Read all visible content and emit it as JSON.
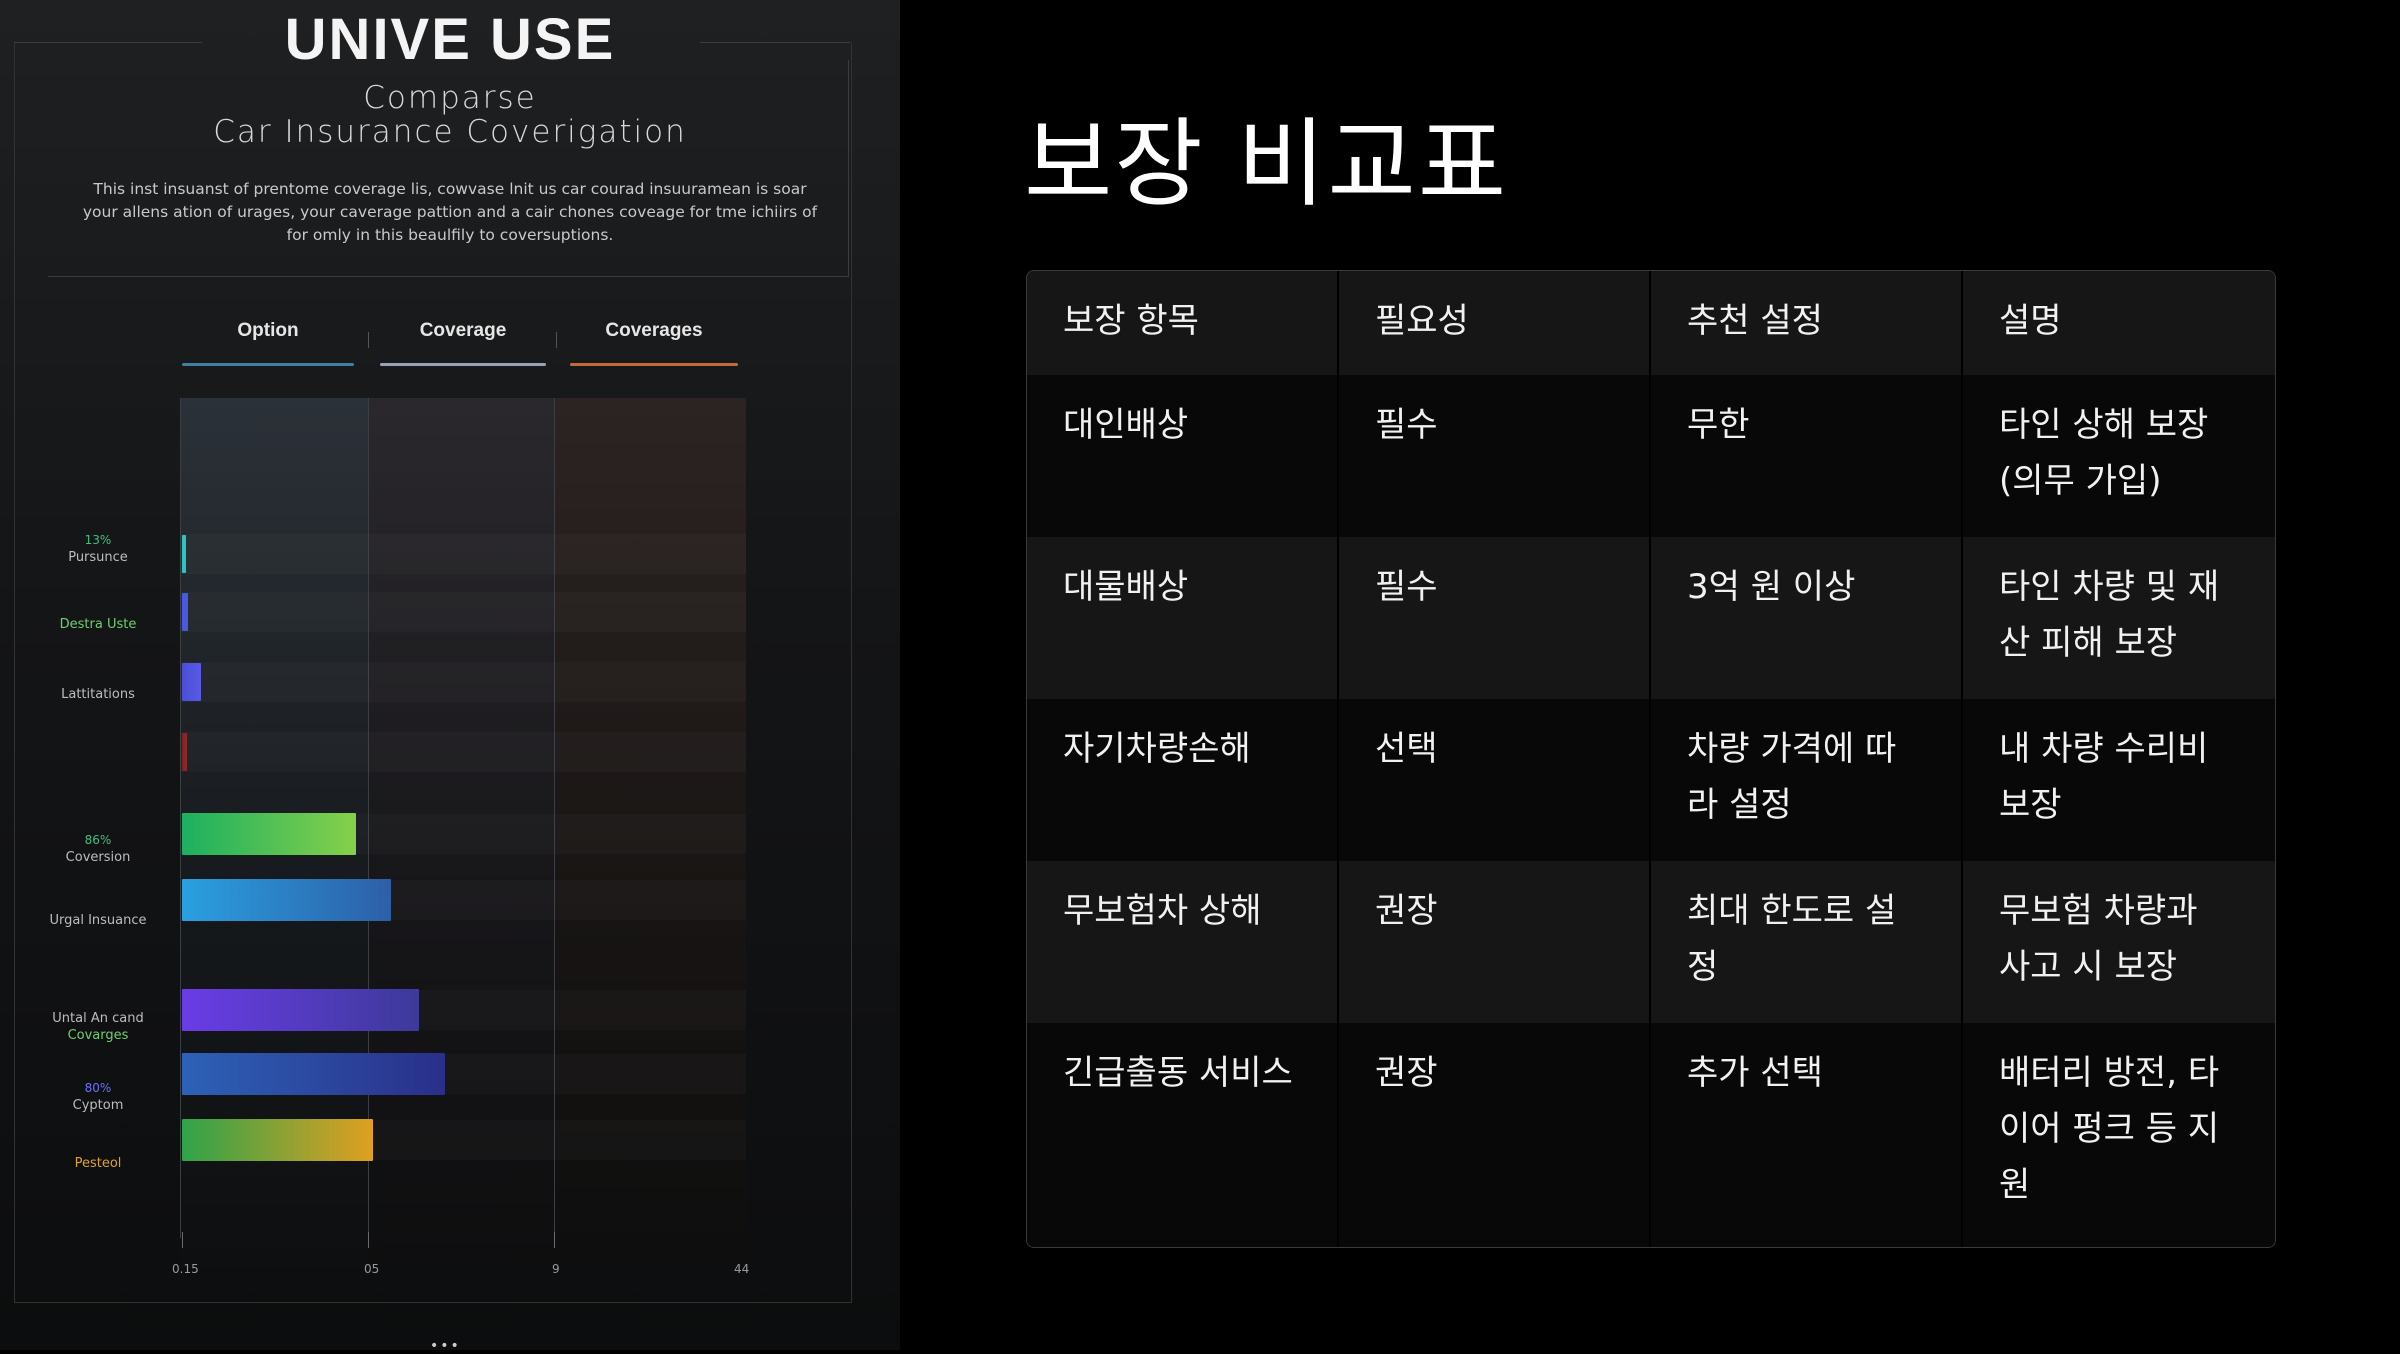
{
  "infographic": {
    "title": "UNIVE USE",
    "subtitle_line1": "Comparse",
    "subtitle_line2": "Car Insurance Coverigation",
    "description": "This inst insuanst of prentome coverage lis, cowvase lnit us car courad insuuramean is soar your allens ation of urages, your caverage pattion and a cair chones coveage for tme ichiirs of for omly in this beaulfily to coversuptions.",
    "tabs": [
      {
        "label": "Option",
        "color": "#3f7fa0"
      },
      {
        "label": "Coverage",
        "color": "#9aa3b6"
      },
      {
        "label": "Coverages",
        "color": "#c46a3a"
      }
    ],
    "rows": [
      {
        "pct": "13%",
        "label": "Pursunce",
        "pct_color": "#3fbf7f"
      },
      {
        "pct": "",
        "label": "Destra Uste",
        "label_color": "#6fcf6f"
      },
      {
        "pct": "",
        "label": "Lattitations"
      },
      {
        "pct": "",
        "label": ""
      },
      {
        "pct": "86%",
        "label": "Coversion",
        "pct_color": "#3fbf7f"
      },
      {
        "pct": "",
        "label": "Urgal Insuance"
      },
      {
        "pct": "",
        "label": "Untal An cand",
        "label2": "Covarges",
        "label2_color": "#6fcf6f"
      },
      {
        "pct": "80%",
        "label": "Cyptom",
        "pct_color": "#6f6fff"
      },
      {
        "pct": "",
        "label": "Pesteol",
        "label_color": "#e0a030"
      }
    ],
    "xticks": [
      "0.15",
      "05",
      "9",
      "44"
    ],
    "dots": "•••"
  },
  "chart_data": {
    "type": "bar",
    "categories": [
      "Pursunce",
      "Destra Uste",
      "Lattitations",
      "",
      "Coversion",
      "Urgal Insuance",
      "Untal An cand Covarges",
      "Cyptom",
      "Pesteol"
    ],
    "values": [
      0.2,
      0.4,
      1.2,
      0.3,
      11.1,
      13.3,
      15.1,
      16.8,
      12.2
    ],
    "colors": [
      [
        "#2ec4c4",
        "#2ec4c4"
      ],
      [
        "#4a5ae0",
        "#4a5ae0"
      ],
      [
        "#4a4fd6",
        "#5a5ae6"
      ],
      [
        "#7a2222",
        "#922a2a"
      ],
      [
        "#1cb060",
        "#86d04a"
      ],
      [
        "#2aa0e0",
        "#2d5fa8"
      ],
      [
        "#6a3ce6",
        "#3d3a9a"
      ],
      [
        "#2d62b6",
        "#2a2f8a"
      ],
      [
        "#2fa34a",
        "#e0a020"
      ]
    ],
    "xlim": [
      0,
      40
    ],
    "xticks": [
      "0.15",
      "05",
      "9",
      "44"
    ],
    "grid": true
  },
  "table": {
    "title": "보장 비교표",
    "headers": [
      "보장 항목",
      "필요성",
      "추천 설정",
      "설명"
    ],
    "rows": [
      [
        "대인배상",
        "필수",
        "무한",
        "타인 상해 보장 (의무 가입)"
      ],
      [
        "대물배상",
        "필수",
        "3억 원 이상",
        "타인 차량 및 재산 피해 보장"
      ],
      [
        "자기차량손해",
        "선택",
        "차량 가격에 따라 설정",
        "내 차량 수리비 보장"
      ],
      [
        "무보험차 상해",
        "권장",
        "최대 한도로 설정",
        "무보험 차량과 사고 시 보장"
      ],
      [
        "긴급출동 서비스",
        "권장",
        "추가 선택",
        "배터리 방전, 타이어 펑크 등 지원"
      ]
    ]
  }
}
